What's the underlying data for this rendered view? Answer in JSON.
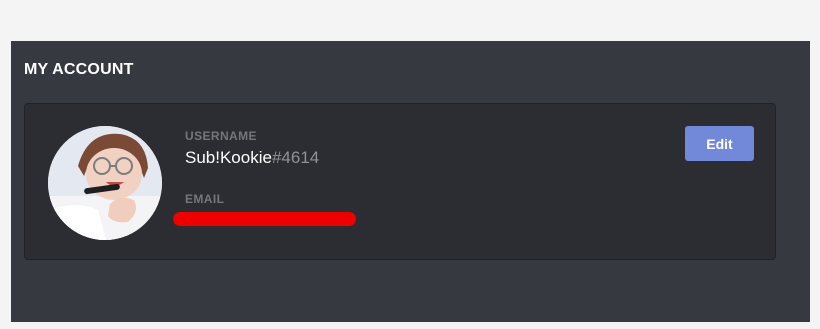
{
  "section": {
    "title": "MY ACCOUNT"
  },
  "account": {
    "username_label": "USERNAME",
    "username": "Sub!Kookie",
    "discriminator": "#4614",
    "email_label": "EMAIL",
    "email_redaction_color": "#ee0000",
    "avatar_icon": "user-photo-avatar"
  },
  "buttons": {
    "edit_label": "Edit"
  },
  "colors": {
    "panel": "#36393f",
    "card": "#2b2d32",
    "accent": "#7289da",
    "label": "#72767d",
    "discriminator": "#8e9297"
  }
}
